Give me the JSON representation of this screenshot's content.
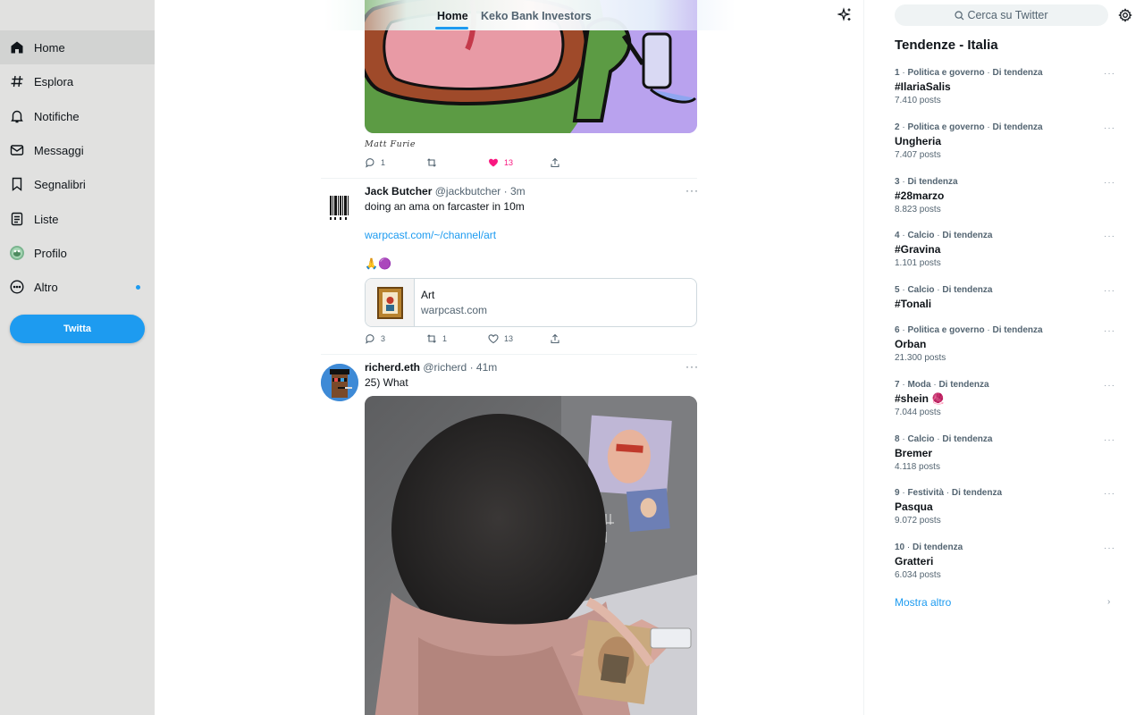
{
  "sidebar": {
    "items": [
      {
        "label": "Home",
        "icon": "home-icon"
      },
      {
        "label": "Esplora",
        "icon": "hashtag-icon"
      },
      {
        "label": "Notifiche",
        "icon": "bell-icon"
      },
      {
        "label": "Messaggi",
        "icon": "mail-icon"
      },
      {
        "label": "Segnalibri",
        "icon": "bookmark-icon"
      },
      {
        "label": "Liste",
        "icon": "list-icon"
      },
      {
        "label": "Profilo",
        "icon": "profile-avatar-icon"
      },
      {
        "label": "Altro",
        "icon": "more-circle-icon"
      }
    ],
    "tweet_button": "Twitta"
  },
  "feed": {
    "tabs": [
      "Home",
      "Keko Bank Investors"
    ],
    "active_tab": "Home",
    "tweet1": {
      "caption": "Matt Furie",
      "replies": "1",
      "likes": "13"
    },
    "tweet2": {
      "name": "Jack Butcher",
      "handle": "@jackbutcher",
      "time": "· 3m",
      "text": "doing an ama on farcaster in 10m",
      "link": "warpcast.com/~/channel/art",
      "emojis": "🙏🟣",
      "card_title": "Art",
      "card_domain": "warpcast.com",
      "replies": "3",
      "retweets": "1",
      "likes": "13"
    },
    "tweet3": {
      "name": "richerd.eth",
      "handle": "@richerd",
      "time": "· 41m",
      "text": "25) What"
    }
  },
  "right": {
    "search_placeholder": "Cerca su Twitter",
    "trends_title": "Tendenze - Italia",
    "trends": [
      {
        "rank": "1",
        "category": "Politica e governo",
        "status": "Di tendenza",
        "name": "#IlariaSalis",
        "count": "7.410 posts"
      },
      {
        "rank": "2",
        "category": "Politica e governo",
        "status": "Di tendenza",
        "name": "Ungheria",
        "count": "7.407 posts"
      },
      {
        "rank": "3",
        "category": "",
        "status": "Di tendenza",
        "name": "#28marzo",
        "count": "8.823 posts"
      },
      {
        "rank": "4",
        "category": "Calcio",
        "status": "Di tendenza",
        "name": "#Gravina",
        "count": "1.101 posts"
      },
      {
        "rank": "5",
        "category": "Calcio",
        "status": "Di tendenza",
        "name": "#Tonali",
        "count": ""
      },
      {
        "rank": "6",
        "category": "Politica e governo",
        "status": "Di tendenza",
        "name": "Orban",
        "count": "21.300 posts"
      },
      {
        "rank": "7",
        "category": "Moda",
        "status": "Di tendenza",
        "name": "#shein 🧶",
        "count": "7.044 posts"
      },
      {
        "rank": "8",
        "category": "Calcio",
        "status": "Di tendenza",
        "name": "Bremer",
        "count": "4.118 posts"
      },
      {
        "rank": "9",
        "category": "Festività",
        "status": "Di tendenza",
        "name": "Pasqua",
        "count": "9.072 posts"
      },
      {
        "rank": "10",
        "category": "",
        "status": "Di tendenza",
        "name": "Gratteri",
        "count": "6.034 posts"
      }
    ],
    "show_more": "Mostra altro"
  },
  "colors": {
    "accent": "#1d9bf0",
    "like_active": "#f91880",
    "sidebar_bg": "#e1e1e0"
  }
}
